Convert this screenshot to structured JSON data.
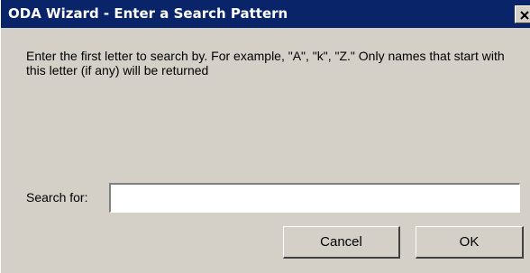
{
  "window": {
    "title": "ODA Wizard - Enter a Search Pattern",
    "close_glyph": "close-icon"
  },
  "main": {
    "instructions": "Enter the first letter to search by. For example, \"A\", \"k\", \"Z.\" Only names that start with this letter (if any) will be returned",
    "search_label": "Search for:",
    "search_value": ""
  },
  "buttons": {
    "cancel_label": "Cancel",
    "ok_label": "OK"
  },
  "colors": {
    "titlebar": "#0a246a",
    "face": "#d4d0c8"
  }
}
